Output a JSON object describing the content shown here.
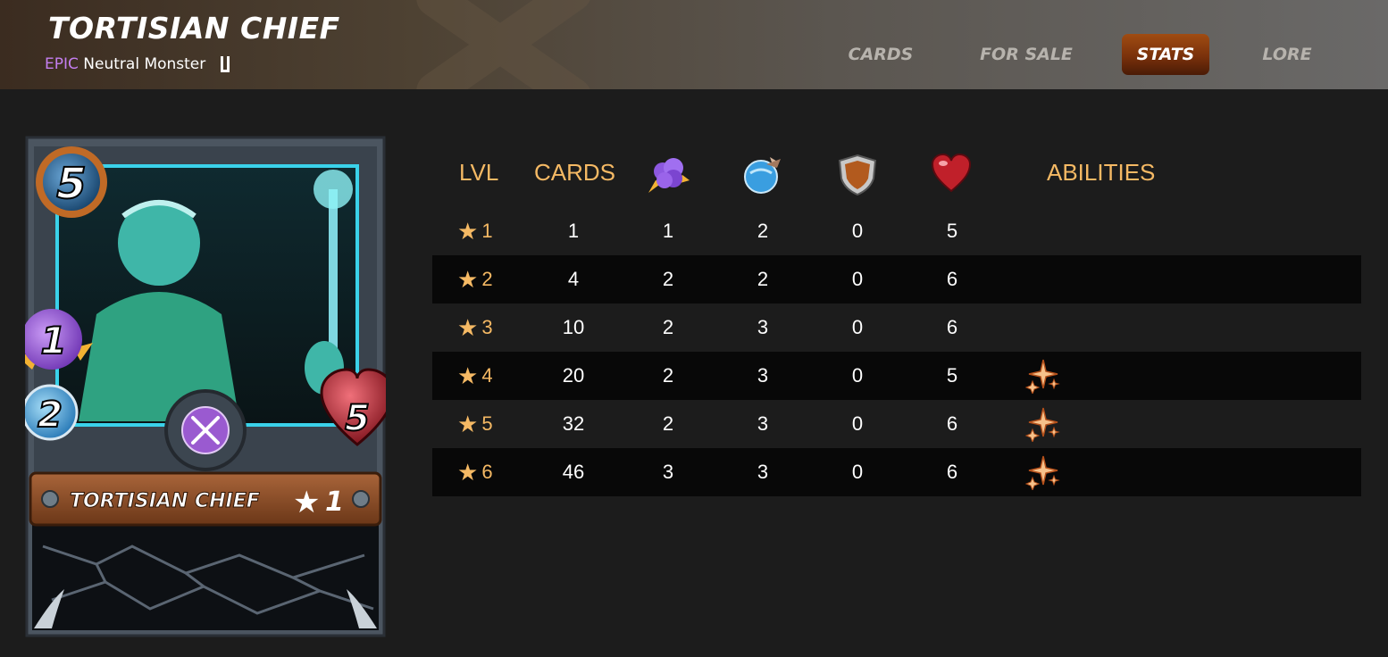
{
  "header": {
    "title": "TORTISIAN CHIEF",
    "rarity": "EPIC",
    "type_text": "Neutral Monster",
    "edition_icon": "untamed-edition-icon"
  },
  "nav": {
    "items": [
      {
        "label": "CARDS",
        "active": false
      },
      {
        "label": "FOR SALE",
        "active": false
      },
      {
        "label": "STATS",
        "active": true
      },
      {
        "label": "LORE",
        "active": false
      }
    ]
  },
  "card": {
    "mana": "5",
    "magic": "1",
    "speed": "2",
    "health": "5",
    "name": "TORTISIAN CHIEF",
    "level": "1",
    "ability_icon": "crossed-swords-icon"
  },
  "table": {
    "headers": {
      "level": "LVL",
      "cards": "CARDS",
      "magic_icon": "magic-attack-icon",
      "speed_icon": "speed-icon",
      "armor_icon": "armor-shield-icon",
      "health_icon": "health-heart-icon",
      "abilities": "ABILITIES"
    },
    "rows": [
      {
        "level": "1",
        "cards": "1",
        "magic": "1",
        "speed": "2",
        "armor": "0",
        "health": "5",
        "ability": ""
      },
      {
        "level": "2",
        "cards": "4",
        "magic": "2",
        "speed": "2",
        "armor": "0",
        "health": "6",
        "ability": ""
      },
      {
        "level": "3",
        "cards": "10",
        "magic": "2",
        "speed": "3",
        "armor": "0",
        "health": "6",
        "ability": ""
      },
      {
        "level": "4",
        "cards": "20",
        "magic": "2",
        "speed": "3",
        "armor": "0",
        "health": "5",
        "ability": "sparkle-ability-icon"
      },
      {
        "level": "5",
        "cards": "32",
        "magic": "2",
        "speed": "3",
        "armor": "0",
        "health": "6",
        "ability": "sparkle-ability-icon"
      },
      {
        "level": "6",
        "cards": "46",
        "magic": "3",
        "speed": "3",
        "armor": "0",
        "health": "6",
        "ability": "sparkle-ability-icon"
      }
    ]
  },
  "colors": {
    "accent": "#f5b964",
    "rarity": "#c47ef0",
    "active_tab": "#8a3a0e",
    "background": "#1c1c1c",
    "row_shade": "#080808"
  }
}
